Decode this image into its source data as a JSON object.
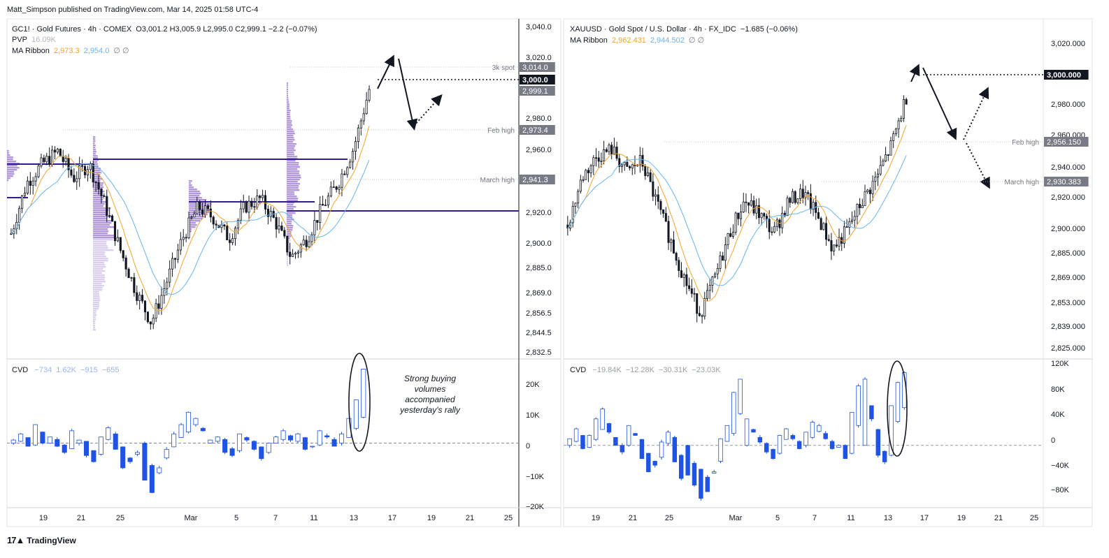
{
  "byline": "Matt_Simpson published on TradingView.com, Mar 14, 2025 01:58 UTC-4",
  "brand": "TradingView",
  "annotation": [
    "Strong buying",
    "volumes",
    "accompanied",
    "yesterday's rally"
  ],
  "colors": {
    "candle_up": "#ffffff",
    "candle_down": "#131722",
    "ma_fast": "#f7a229",
    "ma_slow": "#64b5f6",
    "volume_profile": "#9575cd",
    "cvd": "#1e53e5",
    "poc_line": "#311b92"
  },
  "left_panel": {
    "legend": {
      "symbol": "GC1! · Gold Futures · 4h · COMEX",
      "ohlc": "O3,001.2  H3,005.9  L2,995.0  C2,999.1  −2.2 (−0.07%)",
      "pvp_label": "PVP",
      "pvp_value": "16.09K",
      "ma_label": "MA Ribbon",
      "ma_fast": "2,973.3",
      "ma_slow": "2,954.0",
      "ma_extra": "∅  ∅"
    },
    "cvd_legend": {
      "label": "CVD",
      "values": [
        "−734",
        "1.62K",
        "−915",
        "−655"
      ]
    },
    "price_ticks": [
      "3,040.0",
      "3,020.0",
      "2,980.0",
      "2,960.0",
      "2,920.0",
      "2,900.0",
      "2,885.0",
      "2,869.0",
      "2,856.5",
      "2,844.5",
      "2,832.5"
    ],
    "price_markers": [
      {
        "label": "3k spot",
        "value": "3,014.0",
        "style": "grey"
      },
      {
        "label": "",
        "value": "3,000.0",
        "style": "black"
      },
      {
        "label": "",
        "value": "2,999.1",
        "style": "grey"
      },
      {
        "label": "Feb high",
        "value": "2,973.4",
        "style": "grey"
      },
      {
        "label": "March high",
        "value": "2,941.3",
        "style": "grey"
      }
    ],
    "cvd_ticks": [
      "20K",
      "10K",
      "0",
      "−10K",
      "−20K"
    ],
    "x_ticks": [
      "19",
      "21",
      "25",
      "Mar",
      "5",
      "7",
      "11",
      "13",
      "17",
      "19",
      "21",
      "25"
    ]
  },
  "right_panel": {
    "legend": {
      "symbol": "XAUUSD · Gold Spot / U.S. Dollar · 4h · FX_IDC",
      "change": "−1.685 (−0.06%)",
      "ma_label": "MA Ribbon",
      "ma_fast": "2,962.431",
      "ma_slow": "2,944.502",
      "ma_extra": "∅  ∅"
    },
    "cvd_legend": {
      "label": "CVD",
      "values": [
        "−19.84K",
        "−12.28K",
        "−30.31K",
        "−23.03K"
      ]
    },
    "price_ticks": [
      "3,020.000",
      "2,980.000",
      "2,960.000",
      "2,940.000",
      "2,920.000",
      "2,900.000",
      "2,885.000",
      "2,869.000",
      "2,853.000",
      "2,839.000",
      "2,825.000"
    ],
    "price_markers": [
      {
        "label": "",
        "value": "3,000.000",
        "style": "black"
      },
      {
        "label": "Feb high",
        "value": "2,956.150",
        "style": "grey"
      },
      {
        "label": "March high",
        "value": "2,930.383",
        "style": "grey"
      }
    ],
    "cvd_ticks": [
      "120K",
      "80K",
      "40K",
      "0",
      "−40K",
      "−80K"
    ],
    "x_ticks": [
      "19",
      "21",
      "25",
      "Mar",
      "5",
      "7",
      "11",
      "13",
      "17",
      "19",
      "21",
      "25"
    ]
  },
  "chart_data": [
    {
      "type": "candlestick",
      "title": "GC1! · Gold Futures · 4h · COMEX",
      "ylim": [
        2832.5,
        3040
      ],
      "x": [
        "19",
        "21",
        "25",
        "Mar",
        "5",
        "7",
        "11",
        "13",
        "17",
        "19",
        "21",
        "25"
      ],
      "anchor_closes": [
        2908,
        2940,
        2952,
        2960,
        2943,
        2952,
        2927,
        2898,
        2872,
        2852,
        2878,
        2905,
        2925,
        2918,
        2905,
        2925,
        2930,
        2915,
        2893,
        2905,
        2925,
        2940,
        2962,
        2999.1
      ],
      "levels": {
        "3k spot": 3014.0,
        "round": 3000.0,
        "last": 2999.1,
        "Feb high": 2973.4,
        "March high": 2941.3
      }
    },
    {
      "type": "candlestick",
      "title": "XAUUSD · Gold Spot / U.S. Dollar · 4h · FX_IDC",
      "ylim": [
        2825,
        3030
      ],
      "x": [
        "19",
        "21",
        "25",
        "Mar",
        "5",
        "7",
        "11",
        "13",
        "17",
        "19",
        "21",
        "25"
      ],
      "anchor_closes": [
        2905,
        2935,
        2948,
        2952,
        2938,
        2945,
        2920,
        2895,
        2870,
        2850,
        2872,
        2900,
        2920,
        2912,
        2900,
        2920,
        2925,
        2910,
        2890,
        2902,
        2920,
        2935,
        2955,
        2985
      ],
      "levels": {
        "round": 3000.0,
        "Feb high": 2956.15,
        "March high": 2930.383
      }
    },
    {
      "type": "bar",
      "title": "CVD (GC1!)",
      "ylim": [
        -20000,
        25000
      ],
      "values_k": [
        1,
        3,
        -1,
        6,
        0,
        2,
        -1,
        -3,
        4,
        1,
        -4,
        -6,
        2,
        5,
        -2,
        -8,
        -6,
        -3,
        -12,
        -16,
        -8,
        -2,
        3,
        6,
        10,
        8,
        4,
        1,
        2,
        -3,
        -4,
        3,
        1,
        -2,
        -5,
        0,
        2,
        4,
        1,
        3,
        -2,
        -1,
        4,
        2,
        -1,
        3,
        8,
        14,
        24
      ]
    },
    {
      "type": "bar",
      "title": "CVD (XAUUSD)",
      "ylim": [
        -90000,
        120000
      ],
      "values_k": [
        10,
        25,
        -5,
        15,
        40,
        55,
        20,
        0,
        -10,
        30,
        15,
        -20,
        -40,
        -30,
        5,
        20,
        -25,
        -50,
        -45,
        -60,
        -80,
        -70,
        -40,
        10,
        30,
        80,
        100,
        40,
        20,
        5,
        -10,
        -20,
        15,
        25,
        10,
        -5,
        20,
        35,
        30,
        10,
        -5,
        0,
        -20,
        50,
        90,
        100,
        40,
        -15,
        -25,
        60,
        95,
        110
      ]
    }
  ]
}
